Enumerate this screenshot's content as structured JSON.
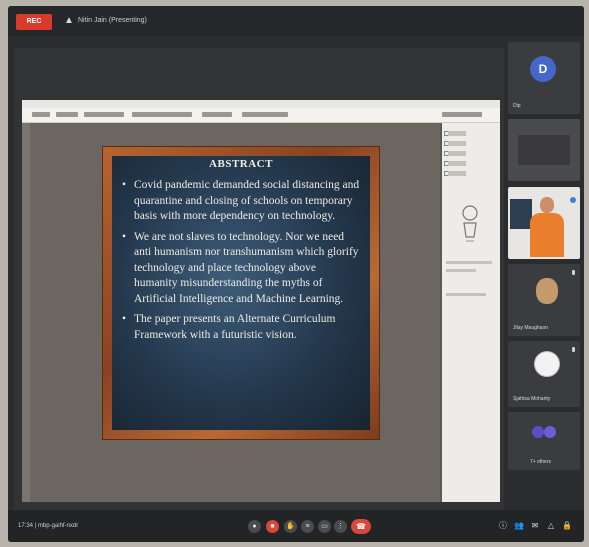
{
  "top_bar": {
    "rec_label": "REC",
    "presenting_text": "Nitin Jain (Presenting)"
  },
  "slide": {
    "title": "ABSTRACT",
    "bullets": [
      "Covid pandemic demanded social distancing and quarantine and closing of schools on temporary basis with more dependency on technology.",
      "We are not slaves to technology. Nor we need anti humanism nor transhumanism which glorify technology and place technology above humanity misunderstanding the myths of Artificial Intelligence and Machine Learning.",
      "The paper presents an Alternate Curriculum Framework with a futuristic vision."
    ]
  },
  "participants": [
    {
      "initial": "D",
      "name": "Dip",
      "color": "#4666c9"
    },
    {
      "initial": "",
      "name": ""
    },
    {
      "initial": "",
      "name": ""
    },
    {
      "initial": "",
      "name": "Jilay Maughaon"
    },
    {
      "initial": "",
      "name": "Sjahtsa Mohanty"
    },
    {
      "initial": "",
      "name": "7+ others"
    }
  ],
  "bottom_bar": {
    "meeting_info": "17:34   |   mbp-gaihf-nxdr"
  },
  "icons": [
    "present-screen-icon",
    "mic-icon",
    "camera-icon",
    "raise-hand-icon",
    "captions-icon",
    "more-options-icon",
    "end-call-icon",
    "info-icon",
    "people-icon",
    "chat-icon",
    "activities-icon",
    "lock-icon"
  ],
  "colors": {
    "accent_red": "#d9463a",
    "slide_board": "#24384d",
    "slide_frame": "#a0522d"
  }
}
